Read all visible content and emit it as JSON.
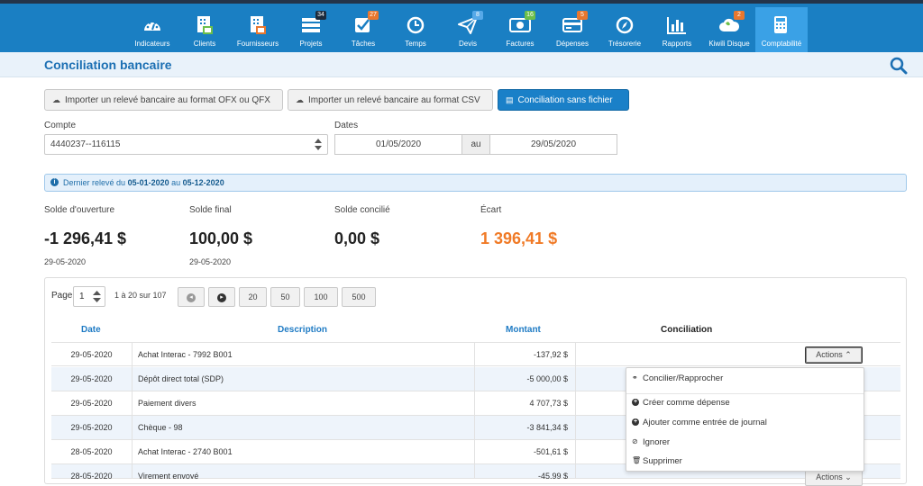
{
  "nav": [
    {
      "label": "Indicateurs",
      "icon": "gauge-icon",
      "badge": ""
    },
    {
      "label": "Clients",
      "icon": "clients-icon",
      "badge": ""
    },
    {
      "label": "Fournisseurs",
      "icon": "suppliers-icon",
      "badge": ""
    },
    {
      "label": "Projets",
      "icon": "projects-icon",
      "badge": "34"
    },
    {
      "label": "Tâches",
      "icon": "tasks-icon",
      "badge": "27"
    },
    {
      "label": "Temps",
      "icon": "clock-icon",
      "badge": ""
    },
    {
      "label": "Devis",
      "icon": "paper-plane-icon",
      "badge": "8"
    },
    {
      "label": "Factures",
      "icon": "invoice-icon",
      "badge": "16"
    },
    {
      "label": "Dépenses",
      "icon": "credit-card-icon",
      "badge": "5"
    },
    {
      "label": "Trésorerie",
      "icon": "compass-icon",
      "badge": ""
    },
    {
      "label": "Rapports",
      "icon": "bar-chart-icon",
      "badge": ""
    },
    {
      "label": "Kiwili Disque",
      "icon": "cloud-icon",
      "badge": "2"
    },
    {
      "label": "Comptabilité",
      "icon": "calculator-icon",
      "badge": ""
    }
  ],
  "page": {
    "title": "Conciliation bancaire"
  },
  "toolbar": {
    "import_ofx": "Importer un relevé bancaire au format OFX ou QFX",
    "import_csv": "Importer un relevé bancaire au format CSV",
    "no_file": "Conciliation sans fichier"
  },
  "filters": {
    "account_label": "Compte",
    "account_value": "4440237--116115",
    "dates_label": "Dates",
    "date_from": "01/05/2020",
    "date_sep": "au",
    "date_to": "29/05/2020"
  },
  "info": {
    "prefix": "Dernier relevé du",
    "from": "05-01-2020",
    "middle": "au",
    "to": "05-12-2020"
  },
  "summary": {
    "opening_label": "Solde d'ouverture",
    "opening_value": "-1 296,41 $",
    "opening_date": "29-05-2020",
    "final_label": "Solde final",
    "final_value": "100,00 $",
    "final_date": "29-05-2020",
    "reconciled_label": "Solde concilié",
    "reconciled_value": "0,00 $",
    "gap_label": "Écart",
    "gap_value": "1 396,41 $"
  },
  "pager": {
    "label": "Page",
    "page": "1",
    "range": "1 à 20 sur 107",
    "sizes": [
      "20",
      "50",
      "100",
      "500"
    ]
  },
  "table": {
    "headers": {
      "date": "Date",
      "description": "Description",
      "amount": "Montant",
      "reconciliation": "Conciliation"
    },
    "rows": [
      {
        "date": "29-05-2020",
        "description": "Achat Interac - 7992 B001",
        "amount": "-137,92 $"
      },
      {
        "date": "29-05-2020",
        "description": "Dépôt direct total (SDP)",
        "amount": "-5 000,00 $"
      },
      {
        "date": "29-05-2020",
        "description": "Paiement divers",
        "amount": "4 707,73 $"
      },
      {
        "date": "29-05-2020",
        "description": "Chèque - 98",
        "amount": "-3 841,34 $"
      },
      {
        "date": "28-05-2020",
        "description": "Achat Interac - 2740 B001",
        "amount": "-501,61 $"
      },
      {
        "date": "28-05-2020",
        "description": "Virement envoyé",
        "amount": "-45,99 $"
      }
    ],
    "actions_label": "Actions"
  },
  "dropdown": {
    "reconcile": "Concilier/Rapprocher",
    "create_expense": "Créer comme dépense",
    "add_journal": "Ajouter comme entrée de journal",
    "ignore": "Ignorer",
    "delete": "Supprimer"
  }
}
